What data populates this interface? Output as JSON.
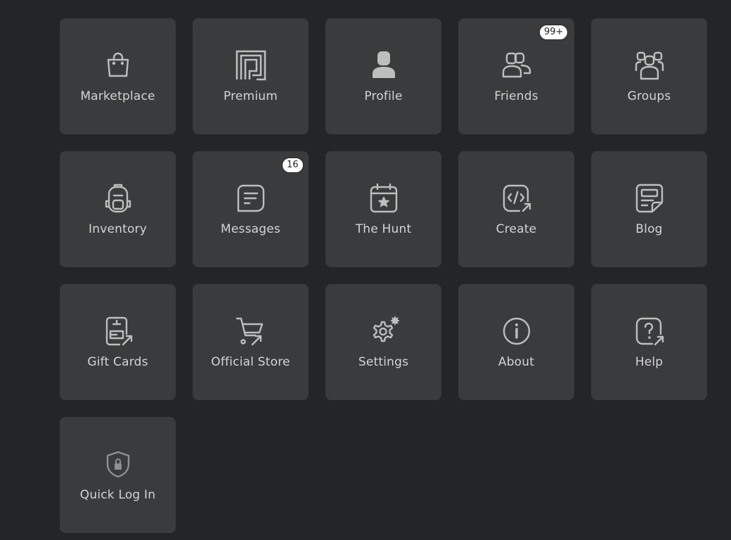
{
  "colors": {
    "background": "#232527",
    "tile": "#393b3d",
    "label": "#d4d4d4",
    "icon": "#bdbebe",
    "badge_bg": "#ffffff"
  },
  "tiles": [
    {
      "label": "Marketplace",
      "icon": "shopping-bag-icon"
    },
    {
      "label": "Premium",
      "icon": "premium-icon"
    },
    {
      "label": "Profile",
      "icon": "profile-icon"
    },
    {
      "label": "Friends",
      "icon": "friends-icon",
      "badge": "99+"
    },
    {
      "label": "Groups",
      "icon": "groups-icon"
    },
    {
      "label": "Inventory",
      "icon": "backpack-icon"
    },
    {
      "label": "Messages",
      "icon": "message-icon",
      "badge": "16"
    },
    {
      "label": "The Hunt",
      "icon": "calendar-star-icon"
    },
    {
      "label": "Create",
      "icon": "code-link-icon"
    },
    {
      "label": "Blog",
      "icon": "blog-icon"
    },
    {
      "label": "Gift Cards",
      "icon": "gift-card-icon"
    },
    {
      "label": "Official Store",
      "icon": "cart-link-icon"
    },
    {
      "label": "Settings",
      "icon": "gear-icon"
    },
    {
      "label": "About",
      "icon": "info-icon"
    },
    {
      "label": "Help",
      "icon": "help-link-icon"
    },
    {
      "label": "Quick Log In",
      "icon": "shield-lock-icon"
    }
  ]
}
